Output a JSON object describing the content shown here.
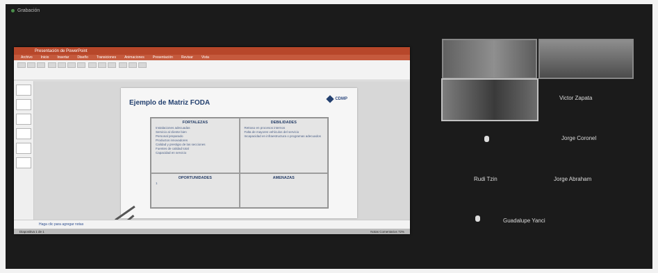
{
  "window": {
    "title": "Grabación"
  },
  "presentation": {
    "app_title": "Presentación de PowerPoint",
    "tabs": [
      "Archivo",
      "Inicio",
      "Insertar",
      "Diseño",
      "Transiciones",
      "Animaciones",
      "Presentación",
      "Revisar",
      "Vista"
    ],
    "slide": {
      "title": "Ejemplo de Matriz FODA",
      "logo": "CDMP",
      "quadrants": [
        {
          "heading": "FORTALEZAS",
          "items": [
            "Instalaciones adecuadas",
            "Servicio al cliente bien",
            "Personal preparado",
            "Productos innovadores",
            "Calidad y prestigio de las secciones",
            "Fuentes de calidad total",
            "Capacidad en servicio"
          ]
        },
        {
          "heading": "DEBILIDADES",
          "items": [
            "Retraso en procesos internos",
            "Falta de mayores vehículos del servicio",
            "Incapacidad en infraestructura o programas adecuados"
          ]
        },
        {
          "heading": "OPORTUNIDADES",
          "items": [
            "1"
          ]
        },
        {
          "heading": "AMENAZAS",
          "items": []
        }
      ]
    },
    "notes_text": "Haga clic para agregar notas",
    "status_left": "Diapositiva 1 de 1",
    "status_right": "Notas Comentarios 72%"
  },
  "participants": [
    {
      "name": "Victor Zapata"
    },
    {
      "name": "Jorge Coronel"
    },
    {
      "name": "Rudi Tzin"
    },
    {
      "name": "Jorge Abraham"
    },
    {
      "name": "Guadalupe Yanci"
    }
  ]
}
